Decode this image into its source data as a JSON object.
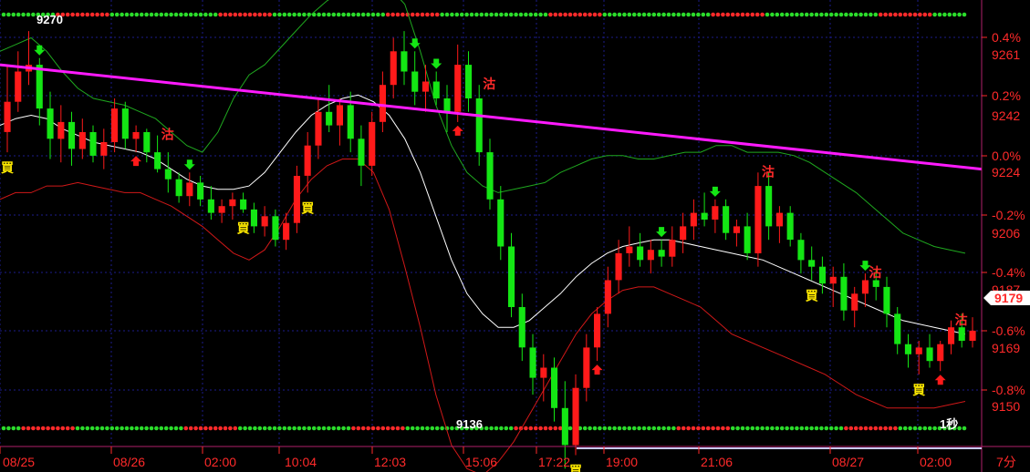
{
  "chart_data": {
    "type": "candlestick",
    "timeframe_label": "7分",
    "x_tick_labels": [
      "08/25",
      "08/26",
      "02:00",
      "10:04",
      "12:03",
      "15:06",
      "17:22",
      "19:00",
      "21:06",
      "08/27",
      "02:00"
    ],
    "y_price_ticks": [
      9261,
      9242,
      9224,
      9206,
      9187,
      9169,
      9150
    ],
    "y_percent_ticks": [
      "0.4%",
      "0.2%",
      "0.0%",
      "-0.2%",
      "-0.4%",
      "-0.6%",
      "-0.8%"
    ],
    "ylim": [
      9133,
      9275
    ],
    "last_price": "9179",
    "top_left_label": "9270",
    "low_label": "9136",
    "bottom_right_label": "1秒",
    "signal_buy": "買",
    "signal_sell": "沽",
    "trendline": {
      "start": 9258,
      "end": 9227
    },
    "candles": [
      [
        9238,
        9258,
        9232,
        9247
      ],
      [
        9247,
        9262,
        9244,
        9256
      ],
      [
        9256,
        9268,
        9252,
        9258
      ],
      [
        9258,
        9260,
        9240,
        9245
      ],
      [
        9245,
        9250,
        9230,
        9236
      ],
      [
        9236,
        9246,
        9229,
        9241
      ],
      [
        9241,
        9244,
        9228,
        9233
      ],
      [
        9233,
        9242,
        9230,
        9238
      ],
      [
        9238,
        9240,
        9229,
        9231
      ],
      [
        9231,
        9239,
        9227,
        9235
      ],
      [
        9235,
        9248,
        9232,
        9245
      ],
      [
        9245,
        9247,
        9233,
        9236
      ],
      [
        9236,
        9240,
        9232,
        9238
      ],
      [
        9238,
        9239,
        9229,
        9232
      ],
      [
        9232,
        9237,
        9226,
        9227
      ],
      [
        9227,
        9232,
        9220,
        9224
      ],
      [
        9224,
        9226,
        9217,
        9219
      ],
      [
        9219,
        9226,
        9216,
        9223
      ],
      [
        9223,
        9225,
        9216,
        9218
      ],
      [
        9218,
        9222,
        9212,
        9214
      ],
      [
        9214,
        9218,
        9211,
        9216
      ],
      [
        9216,
        9220,
        9212,
        9218
      ],
      [
        9218,
        9220,
        9214,
        9215
      ],
      [
        9215,
        9217,
        9208,
        9210
      ],
      [
        9210,
        9216,
        9207,
        9213
      ],
      [
        9213,
        9215,
        9204,
        9206
      ],
      [
        9206,
        9214,
        9203,
        9211
      ],
      [
        9211,
        9228,
        9208,
        9225
      ],
      [
        9225,
        9238,
        9220,
        9234
      ],
      [
        9234,
        9248,
        9230,
        9244
      ],
      [
        9244,
        9252,
        9238,
        9240
      ],
      [
        9240,
        9248,
        9234,
        9246
      ],
      [
        9246,
        9250,
        9232,
        9236
      ],
      [
        9236,
        9240,
        9222,
        9228
      ],
      [
        9228,
        9244,
        9225,
        9241
      ],
      [
        9241,
        9256,
        9238,
        9252
      ],
      [
        9252,
        9266,
        9248,
        9262
      ],
      [
        9262,
        9268,
        9252,
        9256
      ],
      [
        9256,
        9262,
        9246,
        9250
      ],
      [
        9250,
        9258,
        9244,
        9253
      ],
      [
        9253,
        9256,
        9246,
        9248
      ],
      [
        9248,
        9252,
        9238,
        9244
      ],
      [
        9244,
        9264,
        9241,
        9258
      ],
      [
        9258,
        9262,
        9244,
        9248
      ],
      [
        9248,
        9252,
        9228,
        9232
      ],
      [
        9232,
        9236,
        9215,
        9218
      ],
      [
        9218,
        9222,
        9200,
        9204
      ],
      [
        9204,
        9208,
        9183,
        9186
      ],
      [
        9186,
        9190,
        9170,
        9174
      ],
      [
        9174,
        9178,
        9160,
        9165
      ],
      [
        9165,
        9172,
        9158,
        9168
      ],
      [
        9168,
        9171,
        9152,
        9156
      ],
      [
        9156,
        9164,
        9138,
        9145
      ],
      [
        9145,
        9166,
        9142,
        9162
      ],
      [
        9162,
        9178,
        9158,
        9174
      ],
      [
        9174,
        9186,
        9170,
        9184
      ],
      [
        9184,
        9198,
        9180,
        9194
      ],
      [
        9194,
        9206,
        9190,
        9202
      ],
      [
        9202,
        9210,
        9198,
        9204
      ],
      [
        9204,
        9208,
        9198,
        9200
      ],
      [
        9200,
        9206,
        9196,
        9203
      ],
      [
        9203,
        9206,
        9198,
        9201
      ],
      [
        9201,
        9210,
        9198,
        9206
      ],
      [
        9206,
        9214,
        9202,
        9210
      ],
      [
        9210,
        9218,
        9206,
        9214
      ],
      [
        9214,
        9220,
        9210,
        9212
      ],
      [
        9212,
        9218,
        9208,
        9216
      ],
      [
        9216,
        9218,
        9206,
        9208
      ],
      [
        9208,
        9212,
        9204,
        9210
      ],
      [
        9210,
        9214,
        9200,
        9202
      ],
      [
        9202,
        9226,
        9198,
        9222
      ],
      [
        9222,
        9226,
        9206,
        9210
      ],
      [
        9210,
        9216,
        9205,
        9214
      ],
      [
        9214,
        9216,
        9204,
        9206
      ],
      [
        9206,
        9208,
        9196,
        9200
      ],
      [
        9200,
        9204,
        9194,
        9198
      ],
      [
        9198,
        9201,
        9190,
        9193
      ],
      [
        9193,
        9198,
        9186,
        9195
      ],
      [
        9195,
        9199,
        9182,
        9185
      ],
      [
        9185,
        9192,
        9180,
        9190
      ],
      [
        9190,
        9196,
        9186,
        9194
      ],
      [
        9194,
        9197,
        9188,
        9192
      ],
      [
        9192,
        9195,
        9180,
        9184
      ],
      [
        9184,
        9186,
        9172,
        9175
      ],
      [
        9175,
        9178,
        9168,
        9172
      ],
      [
        9172,
        9176,
        9166,
        9174
      ],
      [
        9174,
        9178,
        9168,
        9170
      ],
      [
        9170,
        9176,
        9167,
        9175
      ],
      [
        9175,
        9182,
        9172,
        9180
      ],
      [
        9180,
        9184,
        9174,
        9176
      ],
      [
        9176,
        9183,
        9174,
        9179
      ]
    ],
    "bollinger": {
      "upper": [
        9262,
        9264,
        9266,
        9262,
        9256,
        9251,
        9248,
        9247,
        9246,
        9244,
        9242,
        9238,
        9234,
        9232,
        9238,
        9248,
        9255,
        9258,
        9263,
        9268,
        9273,
        9277,
        9280,
        9282,
        9283,
        9281,
        9276,
        9262,
        9246,
        9234,
        9226,
        9222,
        9220,
        9221,
        9222,
        9223,
        9226,
        9228,
        9230,
        9231,
        9231,
        9230,
        9230,
        9231,
        9232,
        9232,
        9234,
        9234,
        9232,
        9232,
        9232,
        9231,
        9229,
        9226,
        9223,
        9220,
        9216,
        9212,
        9208,
        9206,
        9204,
        9203,
        9202
      ],
      "middle": [
        9240,
        9242,
        9243,
        9242,
        9239,
        9237,
        9235,
        9234,
        9233,
        9232,
        9230,
        9227,
        9224,
        9222,
        9221,
        9221,
        9222,
        9226,
        9232,
        9238,
        9243,
        9246,
        9248,
        9249,
        9247,
        9243,
        9236,
        9226,
        9213,
        9200,
        9190,
        9184,
        9180,
        9180,
        9182,
        9186,
        9190,
        9195,
        9199,
        9202,
        9204,
        9205,
        9206,
        9206,
        9205,
        9204,
        9203,
        9202,
        9201,
        9200,
        9198,
        9196,
        9194,
        9192,
        9190,
        9188,
        9186,
        9184,
        9182,
        9181,
        9180,
        9179,
        9178
      ],
      "lower": [
        9218,
        9220,
        9220,
        9222,
        9222,
        9223,
        9222,
        9221,
        9220,
        9220,
        9218,
        9216,
        9213,
        9210,
        9206,
        9202,
        9200,
        9203,
        9210,
        9218,
        9224,
        9228,
        9230,
        9230,
        9226,
        9215,
        9198,
        9180,
        9160,
        9145,
        9138,
        9136,
        9140,
        9146,
        9154,
        9162,
        9170,
        9178,
        9184,
        9188,
        9191,
        9192,
        9192,
        9190,
        9188,
        9186,
        9182,
        9178,
        9176,
        9174,
        9172,
        9170,
        9168,
        9166,
        9163,
        9160,
        9158,
        9156,
        9156,
        9156,
        9156,
        9157,
        9158
      ]
    },
    "signals": [
      {
        "i": 0,
        "type": "buy"
      },
      {
        "i": 22,
        "type": "buy"
      },
      {
        "i": 28,
        "type": "buy"
      },
      {
        "i": 44,
        "type": "sell"
      },
      {
        "i": 53,
        "type": "buy"
      },
      {
        "i": 75,
        "type": "buy"
      },
      {
        "i": 80,
        "type": "sell"
      },
      {
        "i": 85,
        "type": "buy"
      },
      {
        "i": 88,
        "type": "sell"
      },
      {
        "i": 93,
        "type": "buy"
      },
      {
        "i": 14,
        "type": "sell"
      },
      {
        "i": 70,
        "type": "sell"
      }
    ],
    "arrows": [
      {
        "i": 3,
        "dir": "down"
      },
      {
        "i": 12,
        "dir": "up"
      },
      {
        "i": 17,
        "dir": "down"
      },
      {
        "i": 38,
        "dir": "down"
      },
      {
        "i": 40,
        "dir": "down"
      },
      {
        "i": 42,
        "dir": "up"
      },
      {
        "i": 55,
        "dir": "up"
      },
      {
        "i": 61,
        "dir": "down"
      },
      {
        "i": 66,
        "dir": "down"
      },
      {
        "i": 80,
        "dir": "down"
      },
      {
        "i": 87,
        "dir": "up"
      },
      {
        "i": 92,
        "dir": "down"
      },
      {
        "i": 94,
        "dir": "up"
      }
    ],
    "colors": {
      "up": "#ff1a1a",
      "down": "#14e614",
      "trendline": "#ff1aff",
      "upper_band": "#1fa81f",
      "middle_band": "#ffffff",
      "lower_band": "#d01818",
      "grid": "#1c1c8c",
      "axis_label": "#ff2a2a",
      "buy_label": "#ffea00",
      "sell_label": "#ff2a2a",
      "price_tag": "#ff2a2a"
    }
  }
}
